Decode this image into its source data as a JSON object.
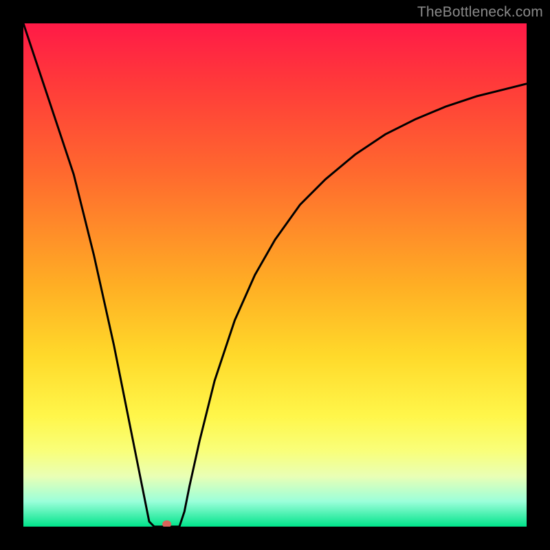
{
  "watermark": "TheBottleneck.com",
  "chart_data": {
    "type": "line",
    "title": "",
    "xlabel": "",
    "ylabel": "",
    "xlim": [
      0,
      100
    ],
    "ylim": [
      0,
      100
    ],
    "grid": false,
    "background": "rainbow-vertical",
    "series": [
      {
        "name": "curve",
        "color": "#000000",
        "x": [
          0,
          2,
          4,
          6,
          8,
          10,
          12,
          14,
          16,
          18,
          20,
          22,
          24,
          25,
          26,
          27,
          28,
          29,
          30,
          31,
          32,
          33,
          35,
          38,
          42,
          46,
          50,
          55,
          60,
          66,
          72,
          78,
          84,
          90,
          96,
          100
        ],
        "y": [
          100,
          94,
          88,
          82,
          76,
          70,
          62,
          54,
          45,
          36,
          26,
          16,
          6,
          1,
          0,
          0,
          0,
          0,
          0,
          0,
          3,
          8,
          17,
          29,
          41,
          50,
          57,
          64,
          69,
          74,
          78,
          81,
          83.5,
          85.5,
          87,
          88
        ]
      }
    ],
    "marker": {
      "x": 28.5,
      "y": 0.5,
      "color": "#d9635a"
    }
  }
}
